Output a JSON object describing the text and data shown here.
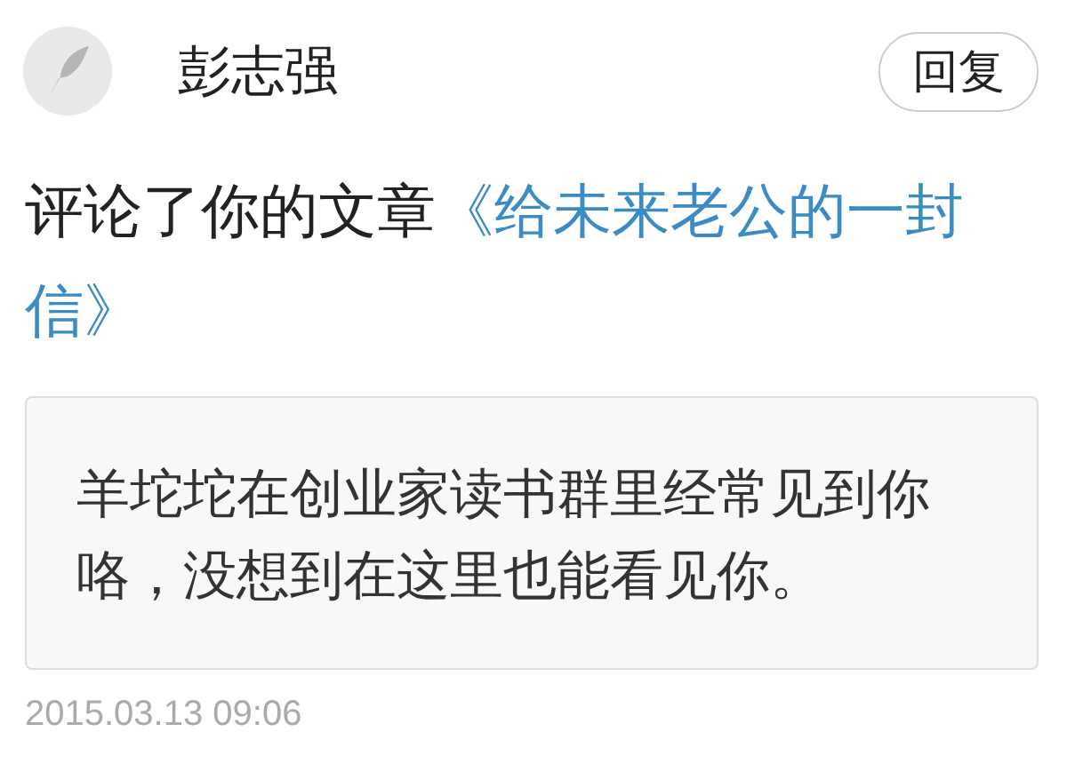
{
  "header": {
    "name": "彭志强",
    "reply_button": "回复"
  },
  "comment": {
    "text": "评论了你的文章",
    "article_title": "《给未来老公的一封信》"
  },
  "quote": {
    "text": "羊坨坨在创业家读书群里经常见到你咯，没想到在这里也能看见你。"
  },
  "timestamp": "2015.03.13 09:06"
}
